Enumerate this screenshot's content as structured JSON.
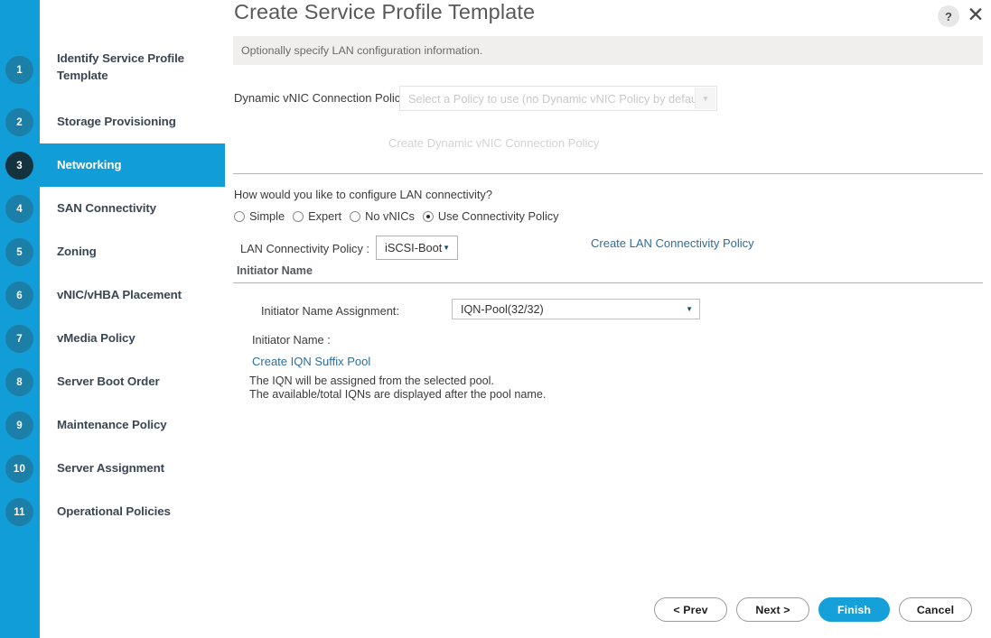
{
  "dialog": {
    "title": "Create Service Profile Template",
    "help_icon": "?",
    "close_icon": "✕",
    "banner_text": "Optionally specify LAN configuration information."
  },
  "sidebar": {
    "steps": [
      {
        "number": "1",
        "label": "Identify Service Profile Template",
        "active": false
      },
      {
        "number": "2",
        "label": "Storage Provisioning",
        "active": false
      },
      {
        "number": "3",
        "label": "Networking",
        "active": true
      },
      {
        "number": "4",
        "label": "SAN Connectivity",
        "active": false
      },
      {
        "number": "5",
        "label": "Zoning",
        "active": false
      },
      {
        "number": "6",
        "label": "vNIC/vHBA Placement",
        "active": false
      },
      {
        "number": "7",
        "label": "vMedia Policy",
        "active": false
      },
      {
        "number": "8",
        "label": "Server Boot Order",
        "active": false
      },
      {
        "number": "9",
        "label": "Maintenance Policy",
        "active": false
      },
      {
        "number": "10",
        "label": "Server Assignment",
        "active": false
      },
      {
        "number": "11",
        "label": "Operational Policies",
        "active": false
      }
    ]
  },
  "form": {
    "dynamic_vnic_label": "Dynamic vNIC Connection Policy:",
    "dynamic_vnic_placeholder": "Select a Policy to use (no Dynamic vNIC Policy by default)",
    "dynamic_vnic_value": "",
    "create_dynamic_vnic_link": "Create Dynamic vNIC Connection Policy",
    "lan_question": "How would you like to configure LAN connectivity?",
    "radios": [
      {
        "label": "Simple",
        "checked": false
      },
      {
        "label": "Expert",
        "checked": false
      },
      {
        "label": "No vNICs",
        "checked": false
      },
      {
        "label": "Use Connectivity Policy",
        "checked": true
      }
    ],
    "lan_policy_label": "LAN Connectivity Policy :",
    "lan_policy_value": "iSCSI-Boot",
    "create_lan_policy_link": "Create LAN Connectivity Policy",
    "initiator_name_heading": "Initiator Name",
    "initiator_assignment_label": "Initiator Name Assignment:",
    "initiator_assignment_value": "IQN-Pool(32/32)",
    "initiator_name_label": "Initiator Name :",
    "initiator_name_value": "",
    "create_iqn_suffix_link": "Create IQN Suffix Pool",
    "hint_line_1": "The IQN will be assigned from the selected pool.",
    "hint_line_2": "The available/total IQNs are displayed after the pool name.",
    "caret_glyph": "▼"
  },
  "footer": {
    "prev_label": "< Prev",
    "next_label": "Next >",
    "finish_label": "Finish",
    "cancel_label": "Cancel"
  },
  "colors": {
    "rail_blue": "#119dd8",
    "active_badge": "#15333f",
    "badge": "#1b7fa7",
    "link_blue": "#2f6d9b",
    "finish_blue": "#16a0d9",
    "banner_gray": "#f0efee"
  }
}
